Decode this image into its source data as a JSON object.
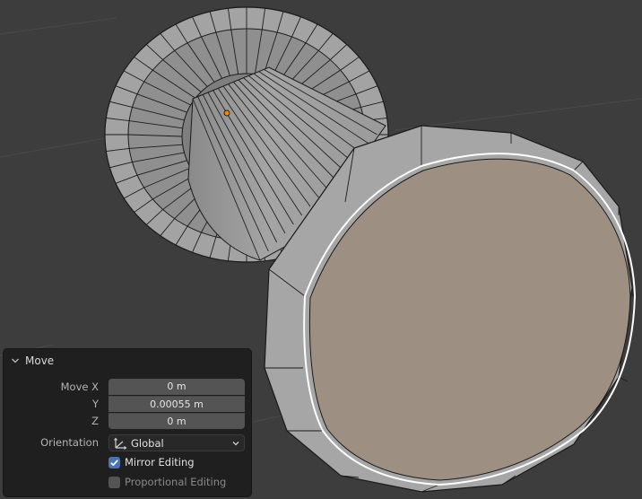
{
  "colors": {
    "viewport_bg": "#3d3d3d",
    "mesh_face": "#9f9f9f",
    "selected_face": "#9d9082",
    "selected_edge": "#ffffff",
    "origin_dot": "#f08a00",
    "panel_bg": "#1f1f1f",
    "field_bg": "#545454",
    "checkbox_on": "#4772b3"
  },
  "operator_panel": {
    "title": "Move",
    "fields": [
      {
        "label": "Move X",
        "value": "0 m"
      },
      {
        "label": "Y",
        "value": "0.00055 m"
      },
      {
        "label": "Z",
        "value": "0 m"
      }
    ],
    "orientation": {
      "label": "Orientation",
      "value": "Global",
      "icon": "orientation-axes-icon"
    },
    "mirror_editing": {
      "label": "Mirror Editing",
      "checked": true
    },
    "proportional_editing": {
      "label": "Proportional Editing",
      "checked": false,
      "enabled": false
    }
  }
}
